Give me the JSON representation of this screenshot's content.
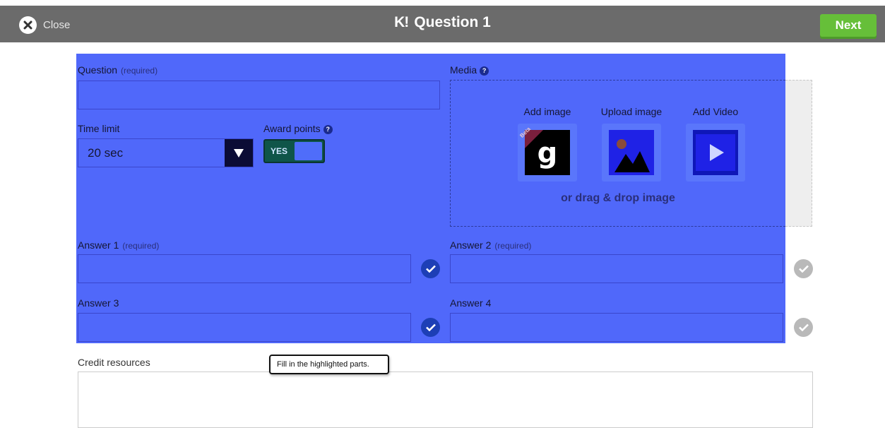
{
  "header": {
    "close_label": "Close",
    "logo_text": "K!",
    "title": "Question 1",
    "next_label": "Next"
  },
  "form": {
    "question": {
      "label": "Question",
      "required_note": "(required)",
      "value": ""
    },
    "time_limit": {
      "label": "Time limit",
      "selected": "20 sec"
    },
    "award_points": {
      "label": "Award points",
      "info_icon": "info-icon",
      "toggle_text": "YES"
    },
    "media": {
      "label": "Media",
      "options": [
        {
          "label": "Add image",
          "icon": "giphy-g-icon",
          "badge": "Beta"
        },
        {
          "label": "Upload image",
          "icon": "image-upload-icon"
        },
        {
          "label": "Add Video",
          "icon": "video-play-icon"
        }
      ],
      "drag_text": "or drag & drop image"
    },
    "answers": [
      {
        "label": "Answer 1",
        "required_note": "(required)",
        "value": "",
        "correct": true
      },
      {
        "label": "Answer 2",
        "required_note": "(required)",
        "value": "",
        "correct": false
      },
      {
        "label": "Answer 3",
        "required_note": "",
        "value": "",
        "correct": true
      },
      {
        "label": "Answer 4",
        "required_note": "",
        "value": "",
        "correct": false
      }
    ],
    "credit": {
      "label": "Credit resources",
      "value": ""
    }
  },
  "tooltip": {
    "text": "Fill in the highlighted parts."
  },
  "colors": {
    "highlight": "#5068fa",
    "topbar": "#6b6b6b",
    "next_button": "#66bf39",
    "check_on": "#1d3fb6",
    "check_off": "#b9b9b9"
  }
}
